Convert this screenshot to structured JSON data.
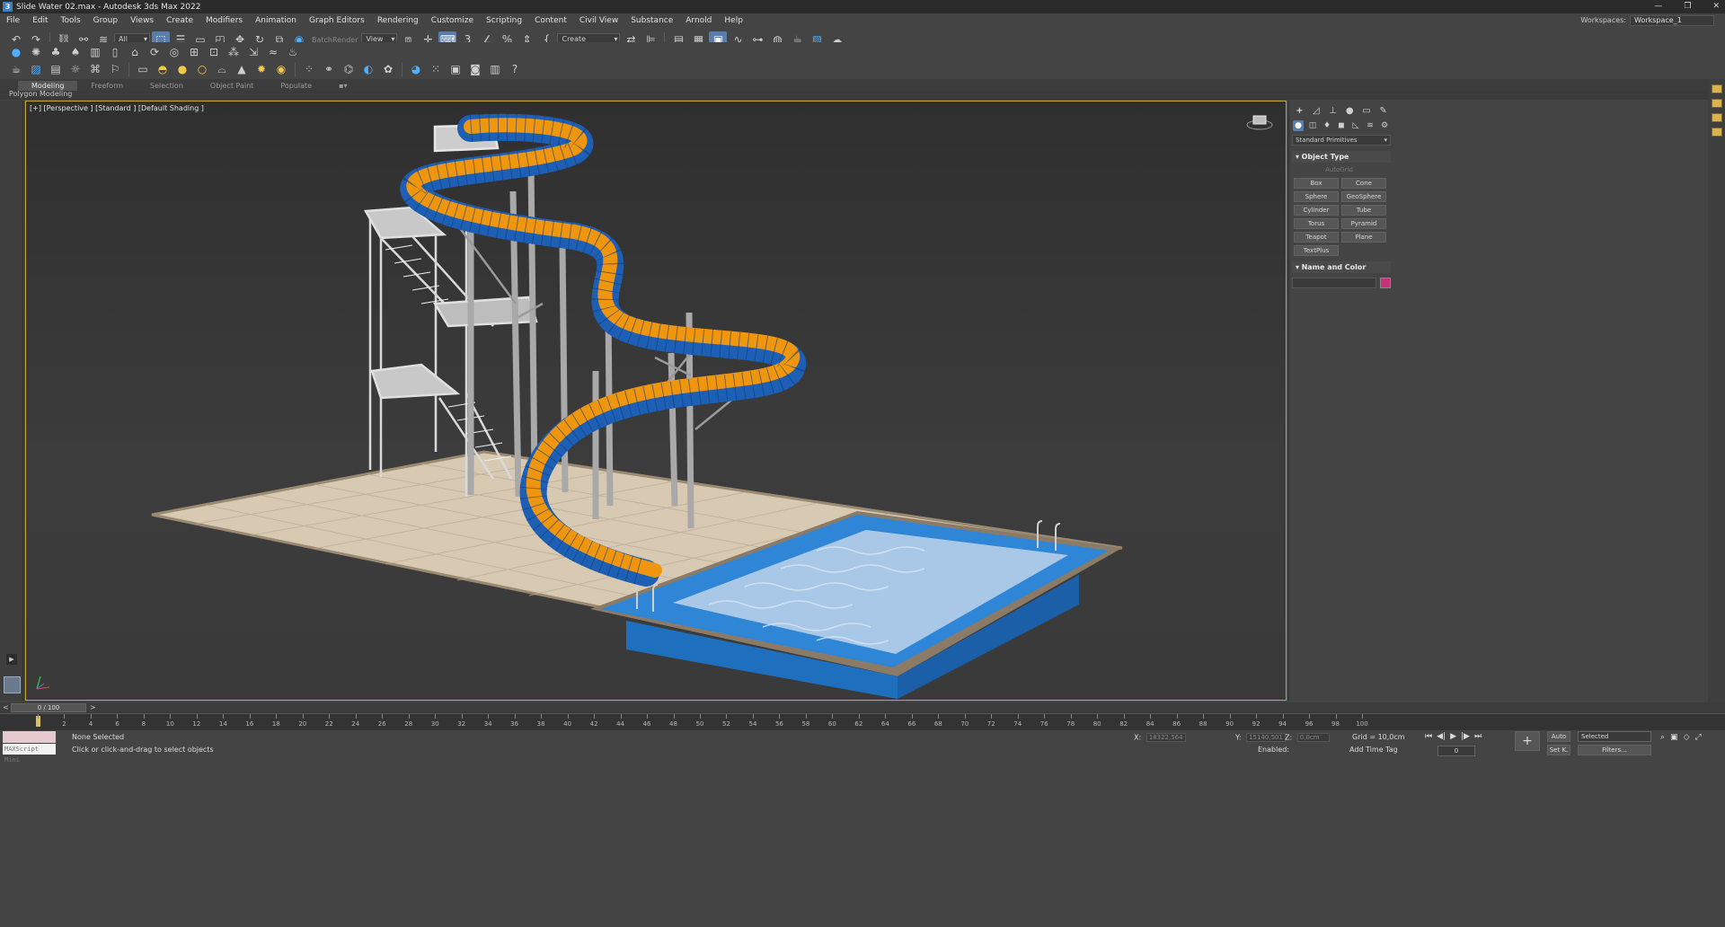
{
  "window": {
    "title": "Slide Water 02.max - Autodesk 3ds Max 2022",
    "app_icon": "3",
    "controls": [
      "—",
      "❐",
      "✕"
    ]
  },
  "menu": [
    "File",
    "Edit",
    "Tools",
    "Group",
    "Views",
    "Create",
    "Modifiers",
    "Animation",
    "Graph Editors",
    "Rendering",
    "Customize",
    "Scripting",
    "Content",
    "Civil View",
    "Substance",
    "Arnold",
    "Help"
  ],
  "workspace": {
    "label": "Workspaces:",
    "value": "Workspace_1"
  },
  "toolbar": {
    "filter_value": "All",
    "batch_render": "BatchRender",
    "ref_coord": "View",
    "selection_set": "Create Selection Set"
  },
  "ribbon": {
    "tabs": [
      "Modeling",
      "Freeform",
      "Selection",
      "Object Paint",
      "Populate"
    ],
    "panel_label": "Polygon Modeling"
  },
  "viewport": {
    "label": "[+] [Perspective ] [Standard ] [Default Shading ]"
  },
  "command_panel": {
    "category": "Standard Primitives",
    "object_type_title": "Object Type",
    "autogrid": "AutoGrid",
    "primitives": [
      "Box",
      "Cone",
      "Sphere",
      "GeoSphere",
      "Cylinder",
      "Tube",
      "Torus",
      "Pyramid",
      "Teapot",
      "Plane",
      "TextPlus"
    ],
    "name_color_title": "Name and Color",
    "swatch_color": "#c8307a"
  },
  "timeline": {
    "frame_display": "0 / 100",
    "ticks": [
      "0",
      "2",
      "4",
      "6",
      "8",
      "10",
      "12",
      "14",
      "16",
      "18",
      "20",
      "22",
      "24",
      "26",
      "28",
      "30",
      "32",
      "34",
      "36",
      "38",
      "40",
      "42",
      "44",
      "46",
      "48",
      "50",
      "52",
      "54",
      "56",
      "58",
      "60",
      "62",
      "64",
      "66",
      "68",
      "70",
      "72",
      "74",
      "76",
      "78",
      "80",
      "82",
      "84",
      "86",
      "88",
      "90",
      "92",
      "94",
      "96",
      "98",
      "100"
    ]
  },
  "status": {
    "maxscript": "MAXScript Mini",
    "selection": "None Selected",
    "prompt": "Click or click-and-drag to select objects",
    "x_label": "X:",
    "x_value": "18322,564",
    "y_label": "Y:",
    "y_value": "15140,501",
    "z_label": "Z:",
    "z_value": "0,0cm",
    "grid": "Grid = 10,0cm",
    "enabled": "Enabled:",
    "add_time_tag": "Add Time Tag",
    "auto": "Auto",
    "set_k": "Set K.",
    "selected": "Selected",
    "filters": "Filters...",
    "frame_field": "0"
  }
}
